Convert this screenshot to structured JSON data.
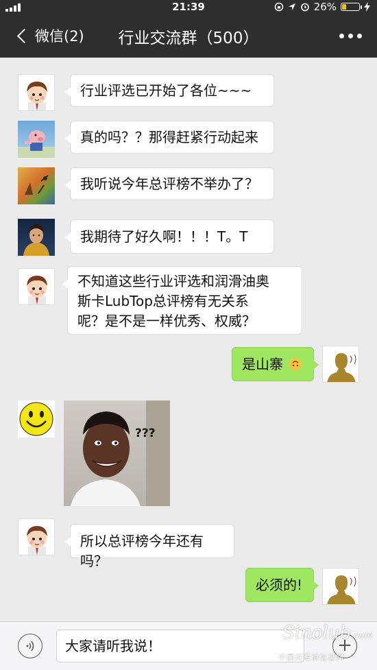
{
  "status_bar": {
    "time": "21:39",
    "battery_percent": "26%",
    "battery_level": 0.26,
    "icons": [
      "signal-icon",
      "rotation-lock-icon",
      "location-icon",
      "alarm-icon",
      "battery-icon",
      "charging-icon"
    ]
  },
  "nav": {
    "back_label": "微信(2)",
    "title": "行业交流群（500）",
    "more_icon": "more-dots-icon"
  },
  "messages": [
    {
      "side": "in",
      "avatar": "cartoon-boy",
      "text": "行业评选已开始了各位~~~"
    },
    {
      "side": "in",
      "avatar": "pig",
      "text": "真的吗？？那得赶紧行动起来"
    },
    {
      "side": "in",
      "avatar": "painting",
      "text": "我听说今年总评榜不举办了？"
    },
    {
      "side": "in",
      "avatar": "portrait",
      "text": "我期待了好久啊！！！T。T"
    },
    {
      "side": "in",
      "avatar": "cartoon-boy",
      "lines": [
        "不知道这些行业评选和润滑油奥",
        "斯卡LubTop总评榜有无关系",
        "呢？是不是一样优秀、权威？"
      ]
    },
    {
      "side": "out",
      "avatar": "me",
      "text": "是山寨",
      "emoji": "upside-down-face-icon"
    },
    {
      "side": "in",
      "avatar": "smiley",
      "image_text": "???"
    },
    {
      "side": "in",
      "avatar": "cartoon-boy",
      "text": "所以总评榜今年还有吗？"
    },
    {
      "side": "out",
      "avatar": "me",
      "text": "必须的!"
    }
  ],
  "input_bar": {
    "value": "大家请听我说！",
    "voice_icon": "voice-icon",
    "emoji_icon": "emoji-icon",
    "plus_icon": "plus-icon"
  },
  "watermark": {
    "logo": "Sinolub",
    "domain": ".com",
    "caption": "中国润滑油信息网"
  },
  "colors": {
    "nav_bg": "#2e2e2e",
    "chat_bg": "#ebebeb",
    "out_bubble": "#9fe661",
    "in_bubble": "#ffffff"
  }
}
